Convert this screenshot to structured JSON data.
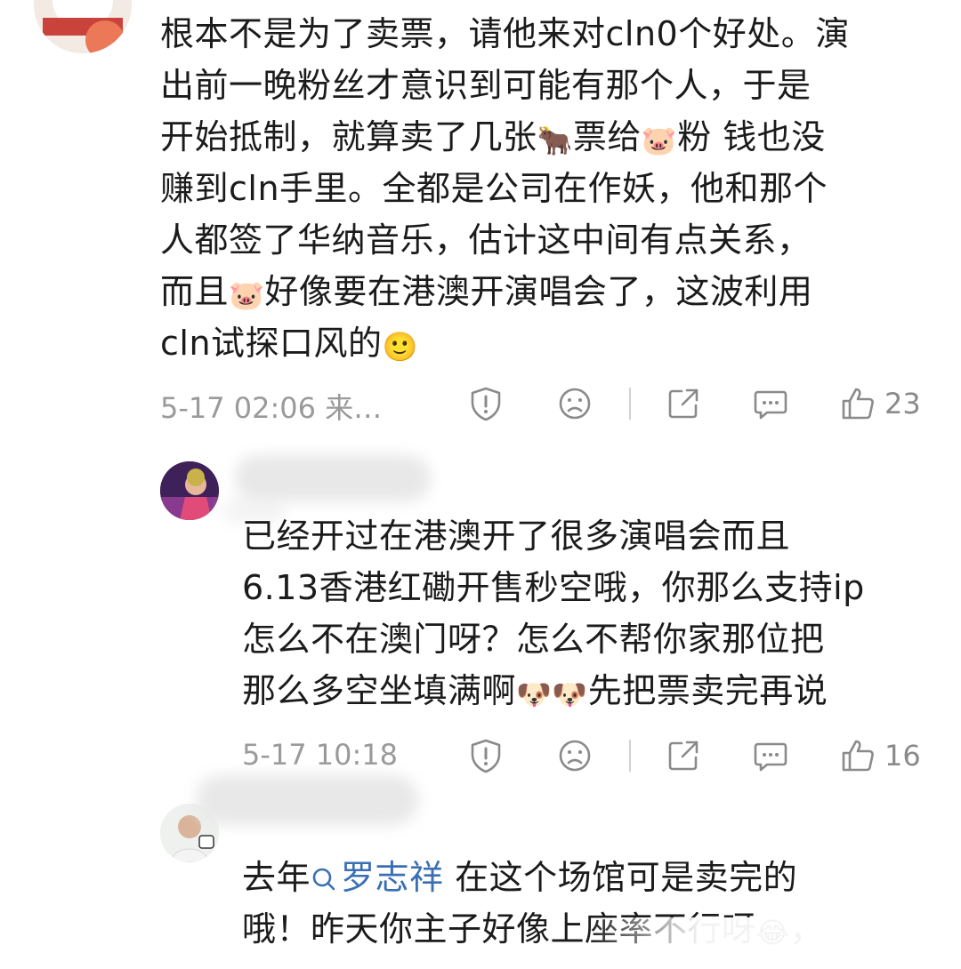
{
  "comments": [
    {
      "lines": [
        "根本不是为了卖票，请他来对cln0个好处。演",
        "出前一晚粉丝才意识到可能有那个人，于是",
        [
          "开始抵制，就算卖了几张",
          "🐂",
          "票给",
          "🐷",
          "粉 钱也没"
        ],
        "赚到cln手里。全都是公司在作妖，他和那个",
        "人都签了华纳音乐，估计这中间有点关系，",
        [
          "而且",
          "🐷",
          "好像要在港澳开演唱会了，这波利用"
        ],
        [
          "cln试探口风的",
          "🙂"
        ]
      ],
      "meta": "5-17 02:06 来…",
      "likes": "23"
    },
    {
      "lines": [
        "已经开过在港澳开了很多演唱会而且",
        "6.13香港红磡开售秒空哦，你那么支持ip",
        "怎么不在澳门呀？怎么不帮你家那位把",
        [
          "那么多空坐填满啊",
          "🐶",
          "🐶",
          "先把票卖完再说"
        ]
      ],
      "meta": "5-17 10:18",
      "likes": "16"
    },
    {
      "line1_prefix": "去年",
      "mention": "罗志祥",
      "line1_suffix": "在这个场馆可是卖完的",
      "line2": [
        "哦！昨天你主子好像上座率不行呀",
        "😂",
        "，"
      ]
    }
  ],
  "icons": {
    "report": "shield-alert-icon",
    "dislike": "frown-face-icon",
    "share": "share-icon",
    "reply": "comment-bubble-icon",
    "like": "thumbs-up-icon",
    "mention": "search-icon"
  },
  "colors": {
    "text": "#1b1b1b",
    "meta": "#9a9a9a",
    "icon": "#8a8a8a",
    "mention": "#3a6fb5"
  }
}
